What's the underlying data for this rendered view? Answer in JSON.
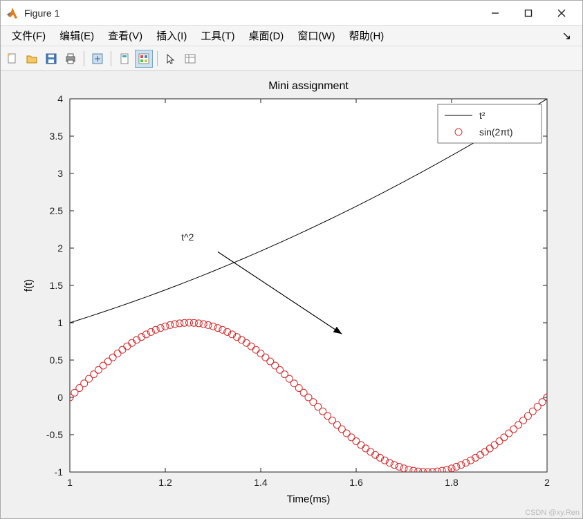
{
  "window": {
    "title": "Figure 1"
  },
  "menu": {
    "items": [
      "文件(F)",
      "编辑(E)",
      "查看(V)",
      "插入(I)",
      "工具(T)",
      "桌面(D)",
      "窗口(W)",
      "帮助(H)"
    ],
    "corner": "↘"
  },
  "toolbar": {
    "icons": [
      "new-file",
      "open-file",
      "save-file",
      "print",
      "separator",
      "data-cursor",
      "separator",
      "link",
      "color-legend",
      "separator",
      "pointer",
      "properties"
    ]
  },
  "watermark": "CSDN @xy.Ren",
  "chart_data": {
    "type": "line+scatter",
    "title": "Mini assignment",
    "xlabel": "Time(ms)",
    "ylabel": "f(t)",
    "xlim": [
      1,
      2
    ],
    "ylim": [
      -1,
      4
    ],
    "xticks": [
      1,
      1.2,
      1.4,
      1.6,
      1.8,
      2
    ],
    "yticks": [
      -1,
      -0.5,
      0,
      0.5,
      1,
      1.5,
      2,
      2.5,
      3,
      3.5,
      4
    ],
    "series": [
      {
        "name": "t^2",
        "legend_label": "t²",
        "style": "line",
        "color": "#000000",
        "x": [
          1.0,
          1.02,
          1.04,
          1.06,
          1.08,
          1.1,
          1.12,
          1.14,
          1.16,
          1.18,
          1.2,
          1.22,
          1.24,
          1.26,
          1.28,
          1.3,
          1.32,
          1.34,
          1.36,
          1.38,
          1.4,
          1.42,
          1.44,
          1.46,
          1.48,
          1.5,
          1.52,
          1.54,
          1.56,
          1.58,
          1.6,
          1.62,
          1.64,
          1.66,
          1.68,
          1.7,
          1.72,
          1.74,
          1.76,
          1.78,
          1.8,
          1.82,
          1.84,
          1.86,
          1.88,
          1.9,
          1.92,
          1.94,
          1.96,
          1.98,
          2.0
        ],
        "y": [
          1.0,
          1.0404,
          1.0816,
          1.1236,
          1.1664,
          1.21,
          1.2544,
          1.2996,
          1.3456,
          1.3924,
          1.44,
          1.4884,
          1.5376,
          1.5876,
          1.6384,
          1.69,
          1.7424,
          1.7956,
          1.8496,
          1.9044,
          1.96,
          2.0164,
          2.0736,
          2.1316,
          2.1904,
          2.25,
          2.3104,
          2.3716,
          2.4336,
          2.4964,
          2.56,
          2.6244,
          2.6896,
          2.7556,
          2.8224,
          2.89,
          2.9584,
          3.0276,
          3.0976,
          3.1684,
          3.24,
          3.3124,
          3.3856,
          3.4596,
          3.5344,
          3.61,
          3.6864,
          3.7636,
          3.8416,
          3.9204,
          4.0
        ]
      },
      {
        "name": "sin(2*pi*t)",
        "legend_label": "sin(2πt)",
        "style": "circle",
        "color": "#d62728",
        "x": [
          1.0,
          1.01,
          1.02,
          1.03,
          1.04,
          1.05,
          1.06,
          1.07,
          1.08,
          1.09,
          1.1,
          1.11,
          1.12,
          1.13,
          1.14,
          1.15,
          1.16,
          1.17,
          1.18,
          1.19,
          1.2,
          1.21,
          1.22,
          1.23,
          1.24,
          1.25,
          1.26,
          1.27,
          1.28,
          1.29,
          1.3,
          1.31,
          1.32,
          1.33,
          1.34,
          1.35,
          1.36,
          1.37,
          1.38,
          1.39,
          1.4,
          1.41,
          1.42,
          1.43,
          1.44,
          1.45,
          1.46,
          1.47,
          1.48,
          1.49,
          1.5,
          1.51,
          1.52,
          1.53,
          1.54,
          1.55,
          1.56,
          1.57,
          1.58,
          1.59,
          1.6,
          1.61,
          1.62,
          1.63,
          1.64,
          1.65,
          1.66,
          1.67,
          1.68,
          1.69,
          1.7,
          1.71,
          1.72,
          1.73,
          1.74,
          1.75,
          1.76,
          1.77,
          1.78,
          1.79,
          1.8,
          1.81,
          1.82,
          1.83,
          1.84,
          1.85,
          1.86,
          1.87,
          1.88,
          1.89,
          1.9,
          1.91,
          1.92,
          1.93,
          1.94,
          1.95,
          1.96,
          1.97,
          1.98,
          1.99,
          2.0
        ],
        "y": [
          0.0,
          0.0628,
          0.1253,
          0.1874,
          0.2487,
          0.309,
          0.3681,
          0.4258,
          0.4818,
          0.5358,
          0.5878,
          0.6374,
          0.6845,
          0.729,
          0.7705,
          0.809,
          0.8443,
          0.8763,
          0.9048,
          0.9298,
          0.9511,
          0.9686,
          0.9823,
          0.9921,
          0.998,
          1.0,
          0.998,
          0.9921,
          0.9823,
          0.9686,
          0.9511,
          0.9298,
          0.9048,
          0.8763,
          0.8443,
          0.809,
          0.7705,
          0.729,
          0.6845,
          0.6374,
          0.5878,
          0.5358,
          0.4818,
          0.4258,
          0.3681,
          0.309,
          0.2487,
          0.1874,
          0.1253,
          0.0628,
          0.0,
          -0.0628,
          -0.1253,
          -0.1874,
          -0.2487,
          -0.309,
          -0.3681,
          -0.4258,
          -0.4818,
          -0.5358,
          -0.5878,
          -0.6374,
          -0.6845,
          -0.729,
          -0.7705,
          -0.809,
          -0.8443,
          -0.8763,
          -0.9048,
          -0.9298,
          -0.9511,
          -0.9686,
          -0.9823,
          -0.9921,
          -0.998,
          -1.0,
          -0.998,
          -0.9921,
          -0.9823,
          -0.9686,
          -0.9511,
          -0.9298,
          -0.9048,
          -0.8763,
          -0.8443,
          -0.809,
          -0.7705,
          -0.729,
          -0.6845,
          -0.6374,
          -0.5878,
          -0.5358,
          -0.4818,
          -0.4258,
          -0.3681,
          -0.309,
          -0.2487,
          -0.1874,
          -0.1253,
          -0.0628,
          0.0
        ]
      }
    ],
    "annotation": {
      "text": "t^2",
      "text_pos": [
        1.26,
        2.1
      ],
      "arrow_start": [
        1.31,
        1.95
      ],
      "arrow_end": [
        1.57,
        0.85
      ]
    },
    "legend_position": "northeast"
  }
}
